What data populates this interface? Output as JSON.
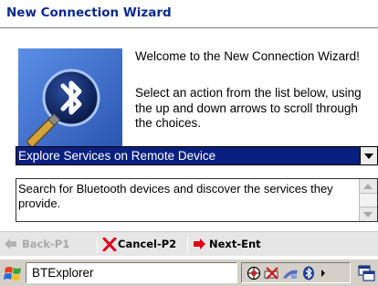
{
  "window": {
    "title": "New Connection Wizard"
  },
  "logo": {
    "icon": "bluetooth-logo-icon",
    "colors": {
      "background": "#3a6ed2",
      "circle": "#0a1f5c",
      "glyph": "#ffffff",
      "pen": "#b8860b"
    }
  },
  "content": {
    "welcome": "Welcome to the New Connection Wizard!",
    "instructions": "Select an action from the list below, using the up and down arrows to scroll through the choices."
  },
  "action_select": {
    "selected": "Explore Services on Remote Device",
    "colors": {
      "highlight": "#0a2080",
      "text": "#ffffff"
    }
  },
  "description": {
    "text": "Search for Bluetooth devices and discover the services they provide."
  },
  "command_bar": {
    "back": {
      "label": "Back-P1",
      "icon": "back-arrow-icon",
      "enabled": false
    },
    "cancel": {
      "label": "Cancel-P2",
      "icon": "red-x-icon"
    },
    "next": {
      "label": "Next-Ent",
      "icon": "forward-arrow-icon"
    }
  },
  "taskbar": {
    "start_icon": "windows-flag-icon",
    "app_label": "BTExplorer",
    "tray_icons": [
      "network-globe-icon",
      "battery-warning-icon",
      "signal-icon",
      "bluetooth-icon",
      "tray-chevron-icon"
    ],
    "desktop_icon": "show-desktop-icon"
  }
}
